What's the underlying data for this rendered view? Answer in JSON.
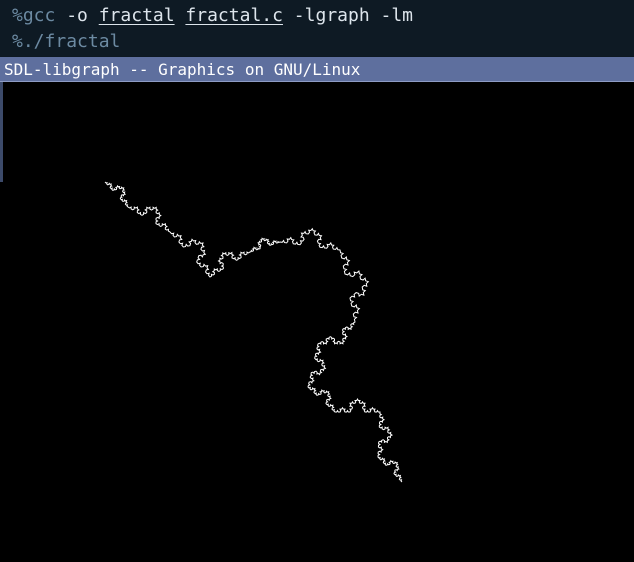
{
  "terminal": {
    "line1": {
      "prompt": "%",
      "command": "gcc",
      "arg1": " -o ",
      "output_file": "fractal",
      "source_file": "fractal.c",
      "flags": " -lgraph -lm"
    },
    "line2": {
      "prompt": "%",
      "command": "./fractal"
    }
  },
  "window": {
    "title": "SDL-libgraph -- Graphics on GNU/Linux"
  },
  "colors": {
    "terminal_bg": "#0e1a24",
    "titlebar_bg": "#5e6f9e",
    "canvas_bg": "#000000",
    "fractal_stroke": "#ffffff"
  }
}
